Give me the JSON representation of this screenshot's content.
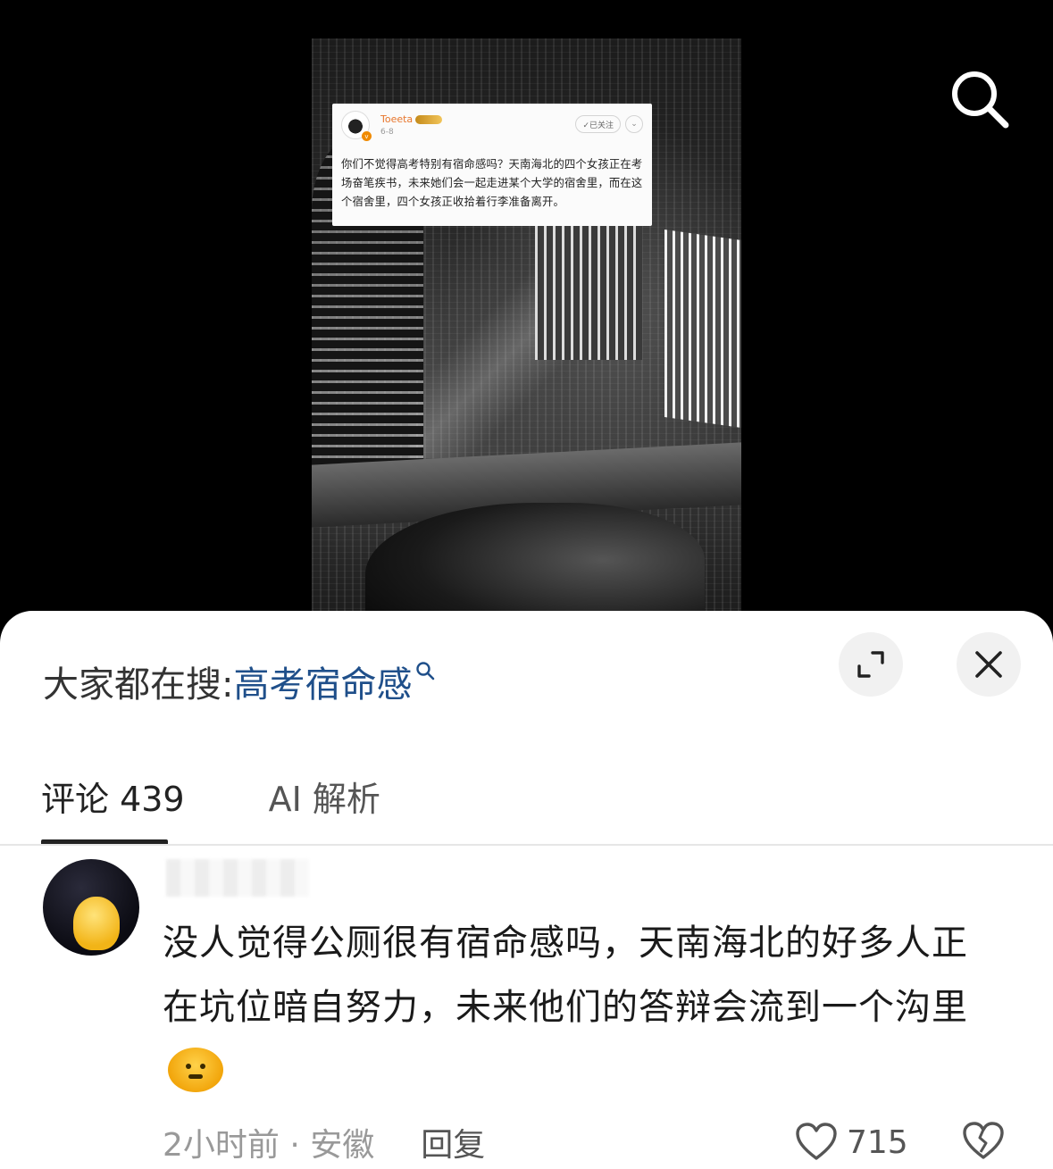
{
  "post_card": {
    "username": "Toeeta",
    "date": "6-8",
    "follow_label": "✓已关注",
    "text": "你们不觉得高考特别有宿命感吗？天南海北的四个女孩正在考场奋笔疾书，未来她们会一起走进某个大学的宿舍里，而在这个宿舍里，四个女孩正收拾着行李准备离开。"
  },
  "sheet": {
    "hot_search_prefix": "大家都在搜:",
    "hot_search_keyword": "高考宿命感",
    "tabs": [
      {
        "label": "评论 439",
        "active": true
      },
      {
        "label": "AI 解析",
        "active": false
      }
    ]
  },
  "comment": {
    "text": "没人觉得公厕很有宿命感吗，天南海北的好多人正在坑位暗自努力，未来他们的答辩会流到一个沟里",
    "emoji": "dizzy-face-emoji",
    "time": "2小时前",
    "location": "安徽",
    "meta": "2小时前 · 安徽",
    "reply_label": "回复",
    "like_count": "715"
  },
  "colors": {
    "keyword_blue": "#1f4f8a",
    "username_orange": "#e8762c"
  }
}
